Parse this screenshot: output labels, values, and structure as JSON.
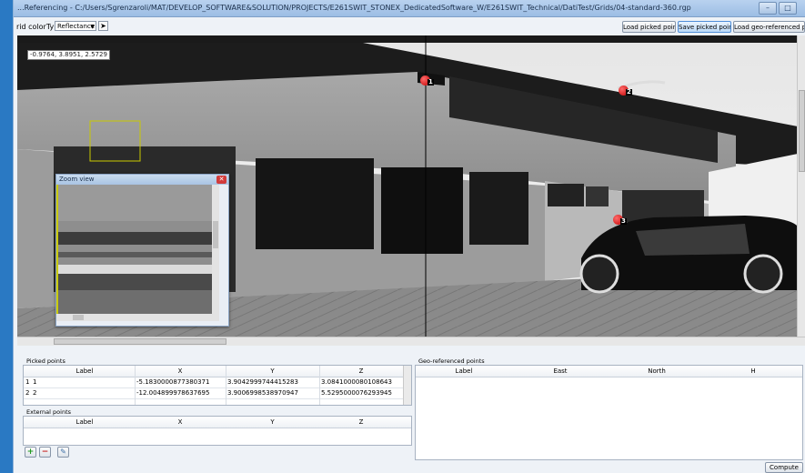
{
  "window": {
    "title": "...Referencing - C:/Users/Sgrenzaroli/MAT/DEVELOP_SOFTWARE&SOLUTION/PROJECTS/E261SWIT_STONEX_DedicatedSoftware_W/E261SWIT_Technical/DatiTest/Grids/04-standard-360.rgp",
    "controls": [
      "–",
      "□"
    ]
  },
  "toolbar": {
    "color_type_label": "rid colorType",
    "color_type_value": "Reflectance",
    "load_picked_label": "Load picked points...",
    "save_picked_label": "Save picked points...",
    "load_geo_label": "Load geo-referenced points..."
  },
  "viewer": {
    "coordinate_readout": "-0.9764, 3.8951, 2.5729",
    "markers": [
      {
        "label": "1"
      },
      {
        "label": "2"
      },
      {
        "label": "3"
      }
    ],
    "zoom_view_title": "Zoom view"
  },
  "picked_points": {
    "title": "Picked points",
    "columns": [
      "Label",
      "X",
      "Y",
      "Z"
    ],
    "rows": [
      {
        "num": "1",
        "label": "1",
        "x": "-5.1830000877380371",
        "y": "3.9042999744415283",
        "z": "3.0841000080108643"
      },
      {
        "num": "2",
        "label": "2",
        "x": "-12.004899978637695",
        "y": "3.9006998538970947",
        "z": "5.5295000076293945"
      }
    ]
  },
  "external_points": {
    "title": "External points",
    "columns": [
      "Label",
      "X",
      "Y",
      "Z"
    ]
  },
  "geo_points": {
    "title": "Geo-referenced points",
    "columns": [
      "Label",
      "East",
      "North",
      "H"
    ]
  },
  "buttons": {
    "compute_label": "Compute"
  }
}
